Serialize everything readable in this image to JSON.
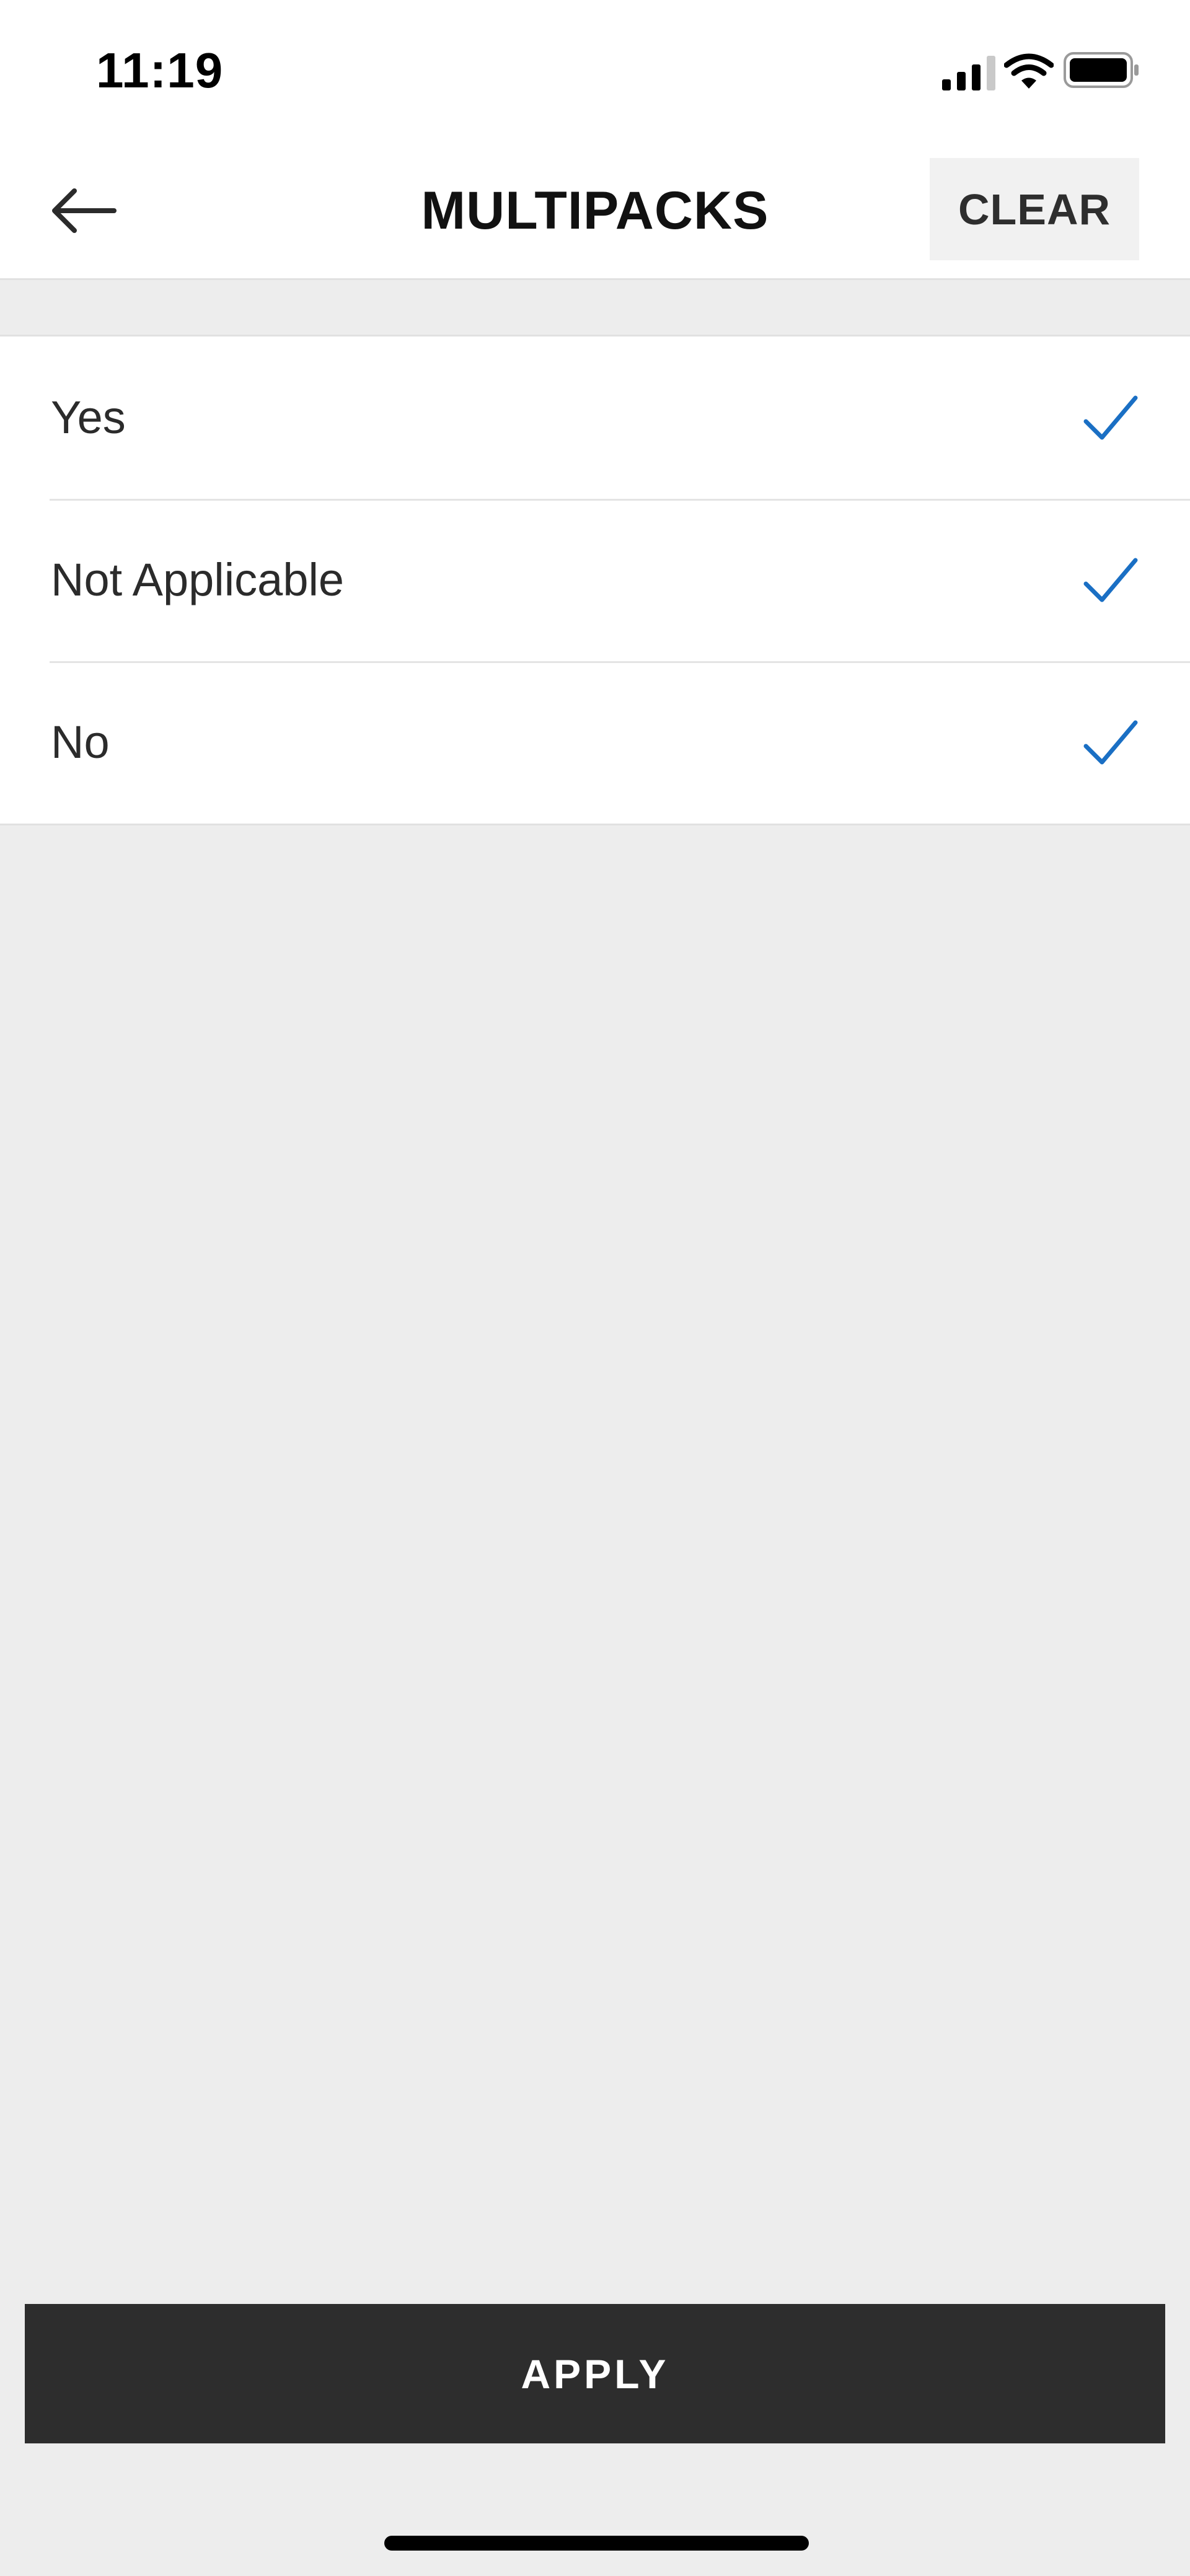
{
  "status_bar": {
    "time": "11:19",
    "icons": [
      "cellular-signal-icon",
      "wifi-icon",
      "battery-icon"
    ]
  },
  "header": {
    "back_icon": "arrow-left-icon",
    "title": "MULTIPACKS",
    "clear_label": "CLEAR"
  },
  "options": [
    {
      "label": "Yes",
      "selected": true
    },
    {
      "label": "Not Applicable",
      "selected": true
    },
    {
      "label": "No",
      "selected": true
    }
  ],
  "footer": {
    "apply_label": "APPLY"
  },
  "colors": {
    "accent_check": "#1a6fc4",
    "apply_background": "#2d2d2d",
    "page_background": "#ededed",
    "clear_background": "#f1f1f1"
  }
}
